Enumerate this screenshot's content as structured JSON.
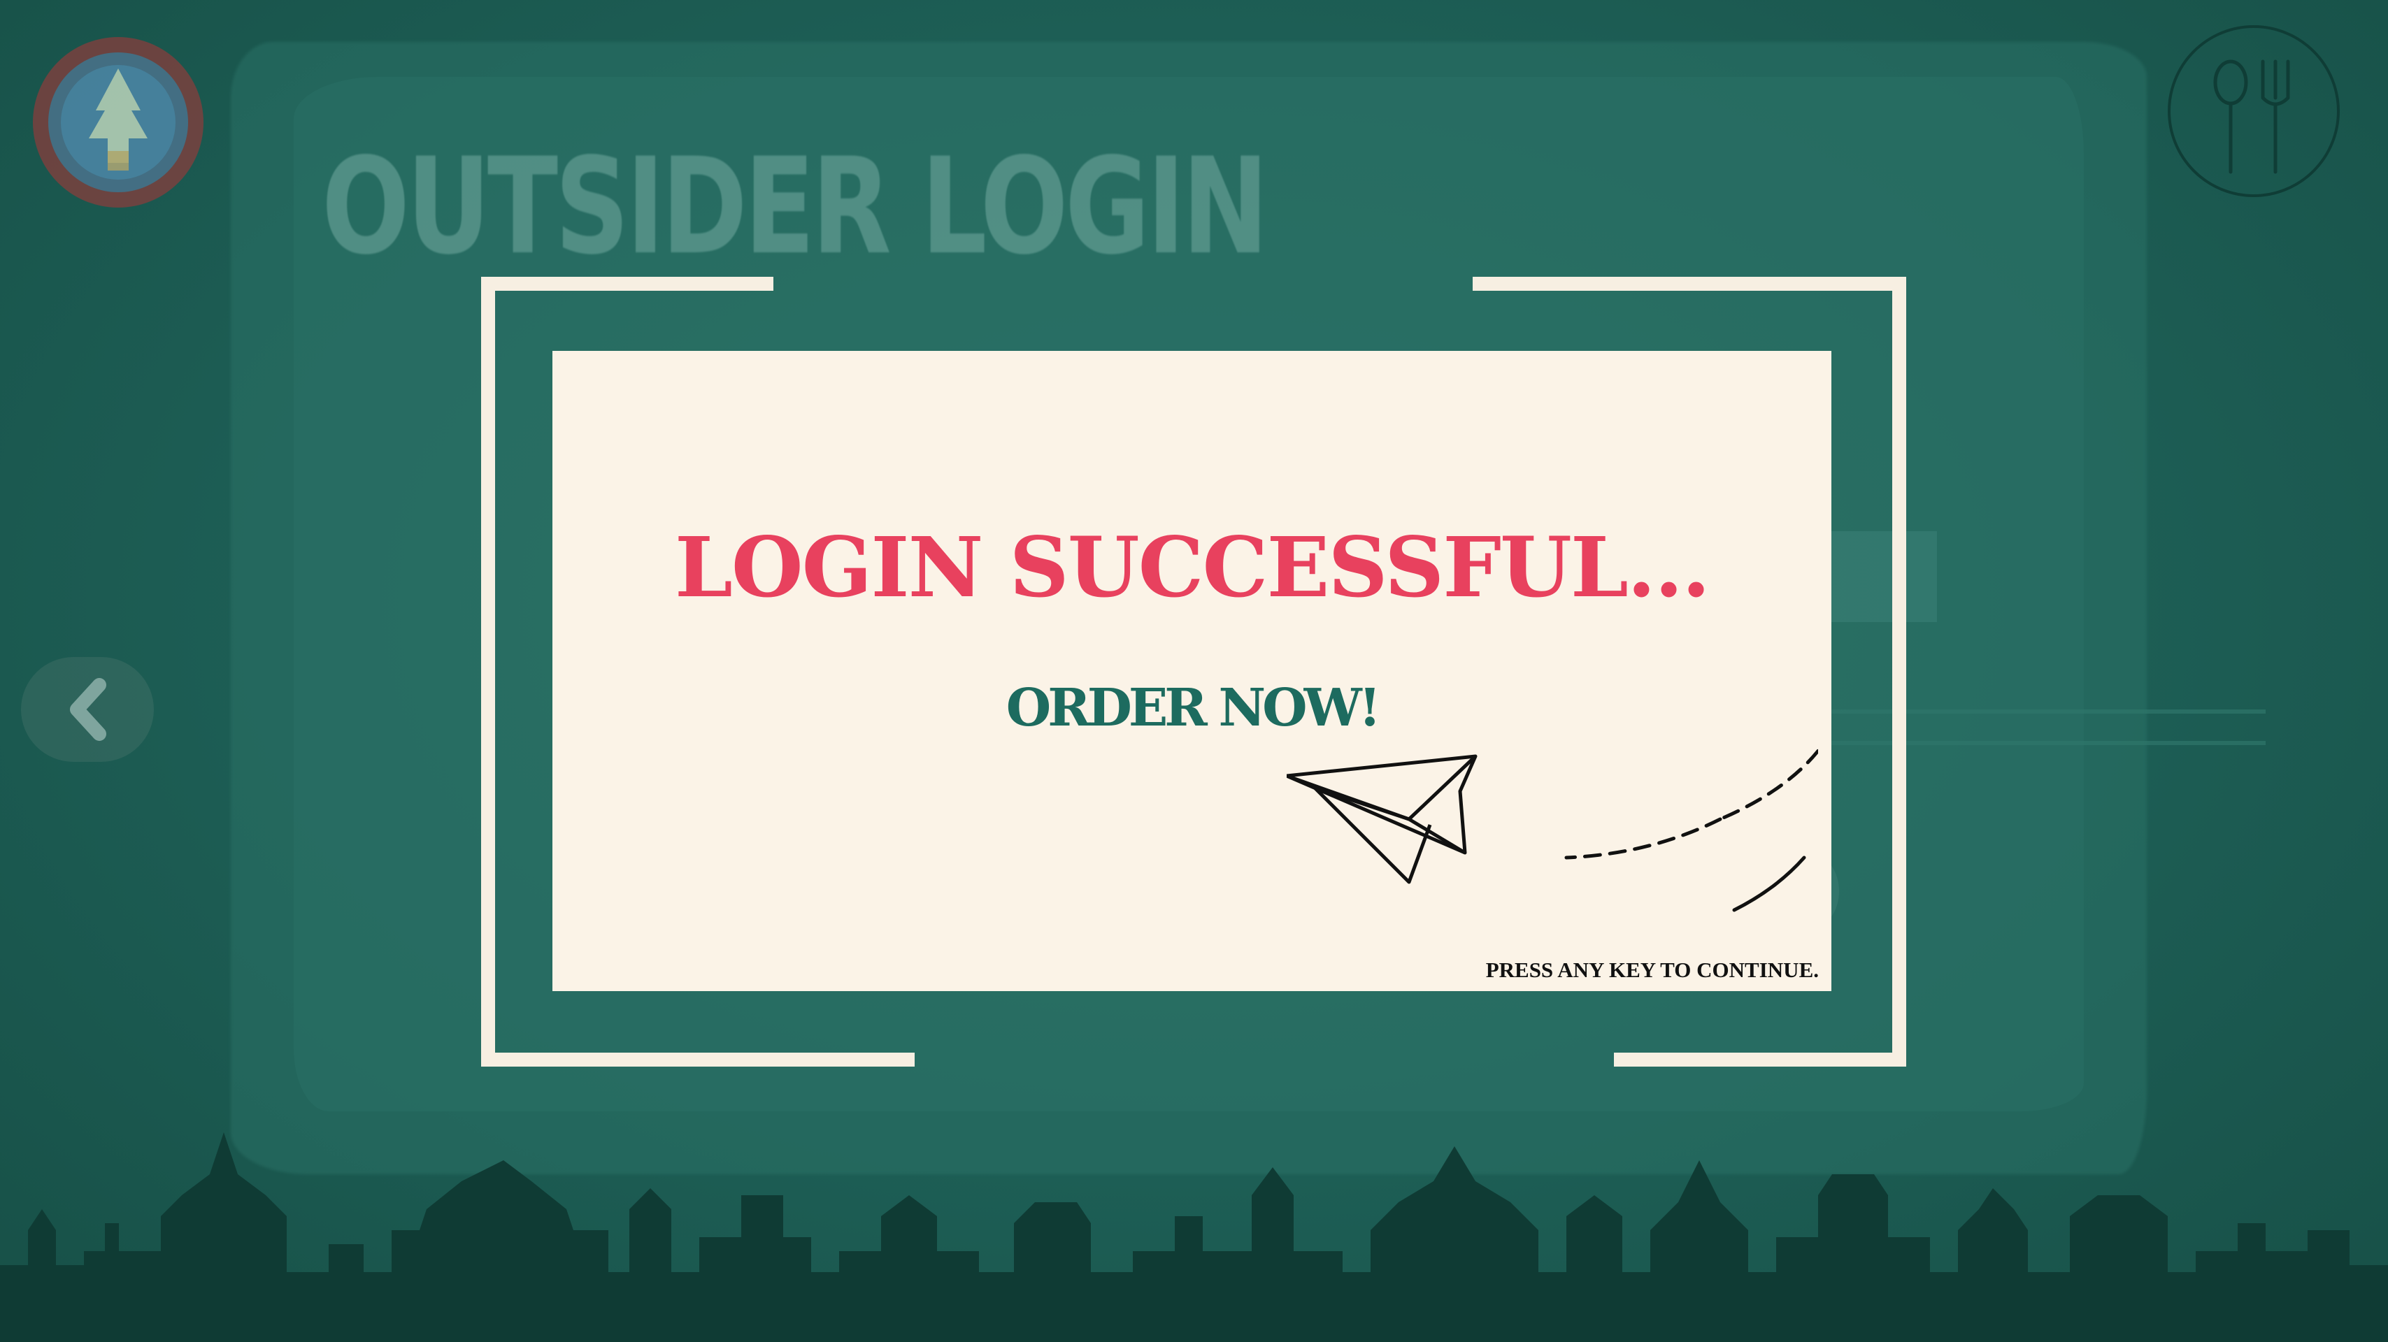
{
  "page": {
    "background_title": "OUTSIDER LOGIN"
  },
  "header": {
    "logo_icon": "college-logo",
    "menu_icon": "cutlery-icon"
  },
  "navigation": {
    "back_icon": "chevron-left-icon"
  },
  "modal": {
    "title": "LOGIN SUCCESSFUL...",
    "cta": "ORDER NOW!",
    "hint": "PRESS ANY KEY TO CONTINUE.",
    "illustration": "paper-plane-icon"
  },
  "colors": {
    "background": "#1d5e55",
    "card": "#fbf3e7",
    "bracket": "#f7efe2",
    "title": "#e8415e",
    "cta": "#1d6b5f",
    "skyline": "#0f3b34"
  }
}
